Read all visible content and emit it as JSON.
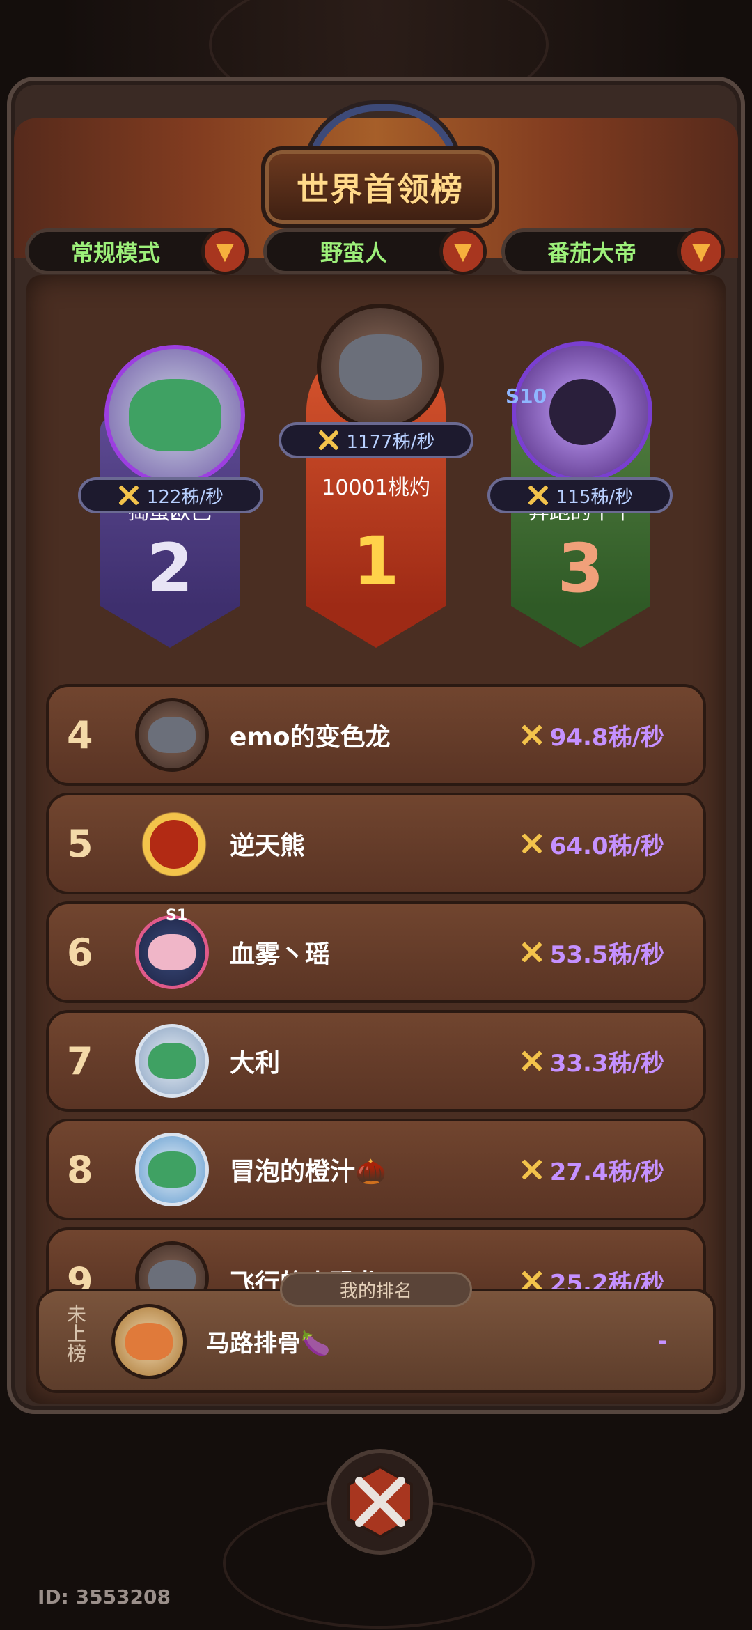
{
  "header": {
    "title": "世界首领榜"
  },
  "filters": [
    {
      "label": "常规模式"
    },
    {
      "label": "野蛮人"
    },
    {
      "label": "番茄大帝"
    }
  ],
  "podium": {
    "first": {
      "rank": "1",
      "speed": "1177秭/秒",
      "name": "10001桃灼"
    },
    "second": {
      "rank": "2",
      "speed": "122秭/秒",
      "name": "捣蛋欧巴"
    },
    "third": {
      "rank": "3",
      "speed": "115秭/秒",
      "name": "奔跑的牛牛",
      "badge": "S10"
    }
  },
  "rows": [
    {
      "rank": "4",
      "name": "emo的变色龙",
      "speed": "94.8秭/秒"
    },
    {
      "rank": "5",
      "name": "逆天熊",
      "speed": "64.0秭/秒"
    },
    {
      "rank": "6",
      "name": "血雾丶瑶",
      "speed": "53.5秭/秒",
      "badge": "S1"
    },
    {
      "rank": "7",
      "name": "大利",
      "speed": "33.3秭/秒"
    },
    {
      "rank": "8",
      "name": "冒泡的橙汁🌰",
      "speed": "27.4秭/秒"
    },
    {
      "rank": "9",
      "name": "飞行的小恐龙",
      "speed": "25.2秭/秒"
    }
  ],
  "my_rank": {
    "tab_label": "我的排名",
    "status": "未上榜",
    "name": "马路排骨🍆",
    "value": "-"
  },
  "footer": {
    "id": "ID: 3553208"
  },
  "colors": {
    "accent_purple": "#c591ff",
    "accent_green": "#9df07a",
    "title_gold": "#ffd98a"
  }
}
